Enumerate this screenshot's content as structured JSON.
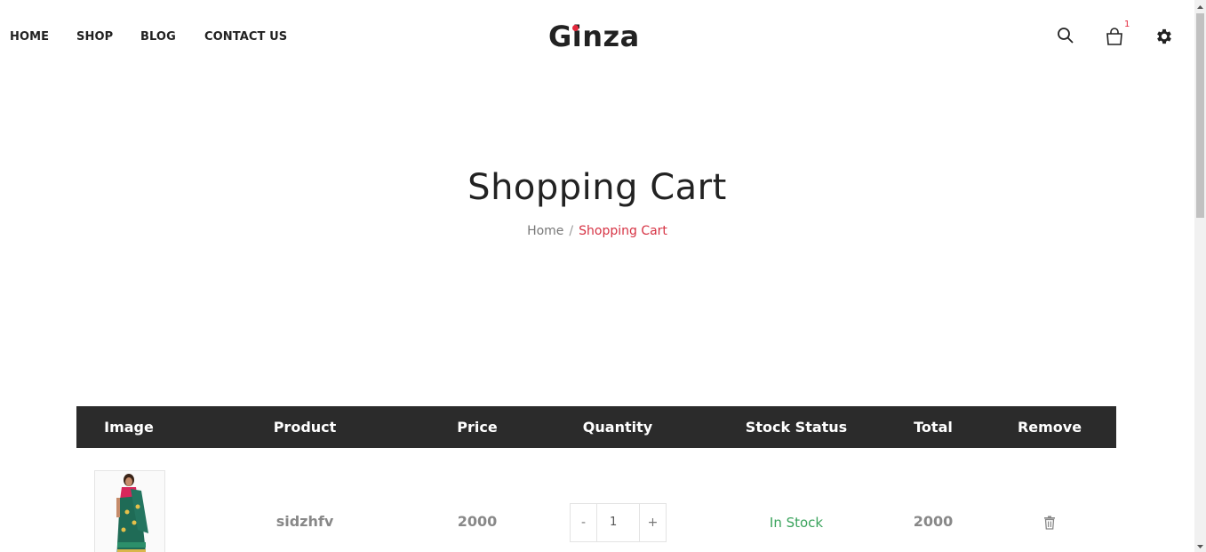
{
  "nav": {
    "home": "HOME",
    "shop": "SHOP",
    "blog": "BLOG",
    "contact": "CONTACT US"
  },
  "brand": {
    "logo": "Ginza",
    "accent": "#e3283c"
  },
  "header_icons": {
    "search": "search-icon",
    "cart": "cart-icon",
    "settings": "gear-icon",
    "cart_count": "1"
  },
  "hero": {
    "title": "Shopping Cart",
    "breadcrumb_home": "Home",
    "breadcrumb_sep": "/",
    "breadcrumb_current": "Shopping Cart"
  },
  "table": {
    "headers": [
      "Image",
      "Product",
      "Price",
      "Quantity",
      "Stock Status",
      "Total",
      "Remove"
    ],
    "rows": [
      {
        "product": "sidzhfv",
        "price": "2000",
        "quantity": "1",
        "stock": "In Stock",
        "total": "2000",
        "minus": "-",
        "plus": "+"
      }
    ]
  },
  "colors": {
    "header_bg": "#2b2b2b",
    "in_stock": "#3aa35c",
    "breadcrumb_active": "#d63243"
  }
}
